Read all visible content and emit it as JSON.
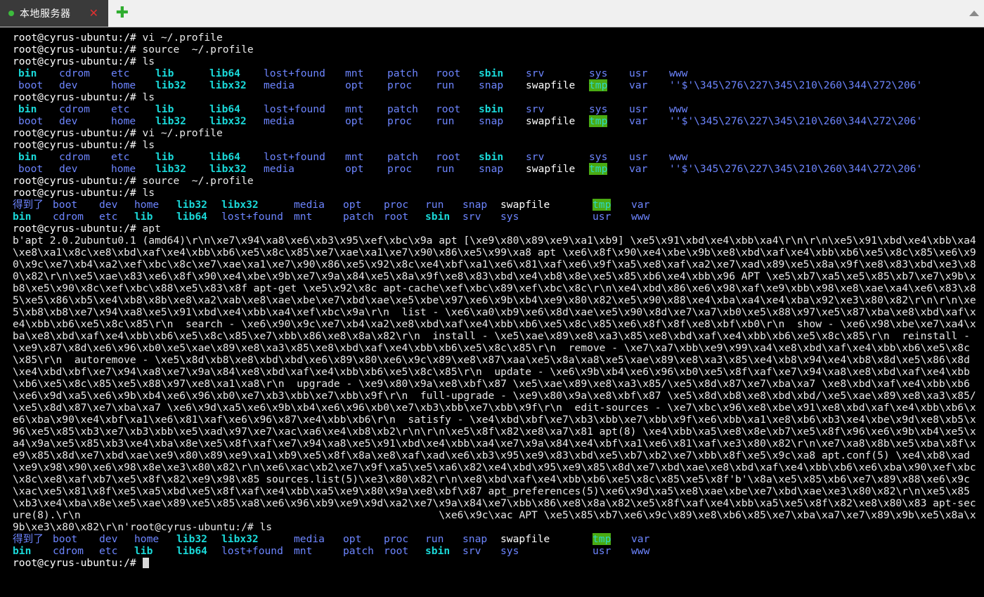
{
  "window": {
    "tab": {
      "status_dot": "status-dot-online",
      "title": "本地服务器",
      "close_label": "✕",
      "add_label": "✚"
    },
    "collapse_icon": "triangle-up-icon"
  },
  "colors": {
    "background": "#000000",
    "foreground": "#e6e6e6",
    "tab_background": "#3a3a3a",
    "tabbar_background": "#f0f0f0",
    "directory": "#6d85ff",
    "symlink": "#1ad9d9",
    "sticky_bg": "#4aab12",
    "sticky_fg": "#2fd6c0",
    "close_red": "#e03030",
    "add_green": "#2fad2f",
    "dot_green": "#3dbb3d"
  },
  "terminal": {
    "prompt": "root@cyrus-ubuntu:/# ",
    "hostname": "cyrus-ubuntu",
    "user": "root",
    "cwd": "/",
    "commands": [
      "vi ~/.profile",
      "source  ~/.profile",
      "ls",
      "apt"
    ],
    "lines": [
      {
        "type": "prompt",
        "command": "vi ~/.profile"
      },
      {
        "type": "prompt",
        "command": "source  ~/.profile"
      },
      {
        "type": "prompt",
        "command": "ls"
      },
      {
        "type": "ls-wide-row1"
      },
      {
        "type": "ls-wide-row2"
      },
      {
        "type": "prompt",
        "command": "ls"
      },
      {
        "type": "ls-wide-row1"
      },
      {
        "type": "ls-wide-row2"
      },
      {
        "type": "prompt",
        "command": "vi ~/.profile"
      },
      {
        "type": "prompt",
        "command": "ls"
      },
      {
        "type": "ls-wide-row1"
      },
      {
        "type": "ls-wide-row2"
      },
      {
        "type": "prompt",
        "command": "source  ~/.profile"
      },
      {
        "type": "prompt",
        "command": "ls"
      },
      {
        "type": "ls-narrow-row1"
      },
      {
        "type": "ls-narrow-row2"
      },
      {
        "type": "prompt",
        "command": "apt"
      },
      {
        "type": "apt-output"
      },
      {
        "type": "ls-narrow-row1"
      },
      {
        "type": "ls-narrow-row2"
      },
      {
        "type": "prompt-cursor",
        "command": ""
      }
    ],
    "ls_wide_row1": [
      {
        "name": "bin",
        "kind": "symlink"
      },
      {
        "name": "cdrom",
        "kind": "dir"
      },
      {
        "name": "etc",
        "kind": "dir"
      },
      {
        "name": "lib",
        "kind": "symlink"
      },
      {
        "name": "lib64",
        "kind": "symlink"
      },
      {
        "name": "lost+found",
        "kind": "dir"
      },
      {
        "name": "mnt",
        "kind": "dir"
      },
      {
        "name": "patch",
        "kind": "dir"
      },
      {
        "name": "root",
        "kind": "dir"
      },
      {
        "name": "sbin",
        "kind": "symlink"
      },
      {
        "name": "srv",
        "kind": "dir"
      },
      {
        "name": "sys",
        "kind": "dir"
      },
      {
        "name": "usr",
        "kind": "dir"
      },
      {
        "name": "www",
        "kind": "dir"
      }
    ],
    "ls_wide_row2": [
      {
        "name": "boot",
        "kind": "dir"
      },
      {
        "name": "dev",
        "kind": "dir"
      },
      {
        "name": "home",
        "kind": "dir"
      },
      {
        "name": "lib32",
        "kind": "symlink"
      },
      {
        "name": "libx32",
        "kind": "symlink"
      },
      {
        "name": "media",
        "kind": "dir"
      },
      {
        "name": "opt",
        "kind": "dir"
      },
      {
        "name": "proc",
        "kind": "dir"
      },
      {
        "name": "run",
        "kind": "dir"
      },
      {
        "name": "snap",
        "kind": "dir"
      },
      {
        "name": "swapfile",
        "kind": "file"
      },
      {
        "name": "tmp",
        "kind": "sticky"
      },
      {
        "name": "var",
        "kind": "dir"
      },
      {
        "name": "''$'\\345\\276\\227\\345\\210\\260\\344\\272\\206'",
        "kind": "dir"
      }
    ],
    "ls_narrow_row1": [
      {
        "name": "得到了",
        "kind": "dir"
      },
      {
        "name": "boot",
        "kind": "dir"
      },
      {
        "name": "dev",
        "kind": "dir"
      },
      {
        "name": "home",
        "kind": "dir"
      },
      {
        "name": "lib32",
        "kind": "symlink"
      },
      {
        "name": "libx32",
        "kind": "symlink"
      },
      {
        "name": "media",
        "kind": "dir"
      },
      {
        "name": "opt",
        "kind": "dir"
      },
      {
        "name": "proc",
        "kind": "dir"
      },
      {
        "name": "run",
        "kind": "dir"
      },
      {
        "name": "snap",
        "kind": "dir"
      },
      {
        "name": "swapfile",
        "kind": "file"
      },
      {
        "name": "tmp",
        "kind": "sticky"
      },
      {
        "name": "var",
        "kind": "dir"
      }
    ],
    "ls_narrow_row2": [
      {
        "name": "bin",
        "kind": "symlink"
      },
      {
        "name": "cdrom",
        "kind": "dir"
      },
      {
        "name": "etc",
        "kind": "dir"
      },
      {
        "name": "lib",
        "kind": "symlink"
      },
      {
        "name": "lib64",
        "kind": "symlink"
      },
      {
        "name": "lost+found",
        "kind": "dir"
      },
      {
        "name": "mnt",
        "kind": "dir"
      },
      {
        "name": "patch",
        "kind": "dir"
      },
      {
        "name": "root",
        "kind": "dir"
      },
      {
        "name": "sbin",
        "kind": "symlink"
      },
      {
        "name": "srv",
        "kind": "dir"
      },
      {
        "name": "sys",
        "kind": "dir"
      },
      {
        "name": "usr",
        "kind": "dir"
      },
      {
        "name": "www",
        "kind": "dir"
      }
    ],
    "apt_output": "b'apt 2.0.2ubuntu0.1 (amd64)\\r\\n\\xe7\\x94\\xa8\\xe6\\xb3\\x95\\xef\\xbc\\x9a apt [\\xe9\\x80\\x89\\xe9\\xa1\\xb9] \\xe5\\x91\\xbd\\xe4\\xbb\\xa4\\r\\n\\r\\n\\xe5\\x91\\xbd\\xe4\\xbb\\xa4\\xe8\\xa1\\x8c\\xe8\\xbd\\xaf\\xe4\\xbb\\xb6\\xe5\\x8c\\x85\\xe7\\xae\\xa1\\xe7\\x90\\x86\\xe5\\x99\\xa8 apt \\xe6\\x8f\\x90\\xe4\\xbe\\x9b\\xe8\\xbd\\xaf\\xe4\\xbb\\xb6\\xe5\\x8c\\x85\\xe6\\x90\\x9c\\xe7\\xb4\\xa2\\xef\\xbc\\x8c\\xe7\\xae\\xa1\\xe7\\x90\\x86\\xe5\\x92\\x8c\\xe4\\xbf\\xa1\\xe6\\x81\\xaf\\xe6\\x9f\\xa5\\xe8\\xaf\\xa2\\xe7\\xad\\x89\\xe5\\x8a\\x9f\\xe8\\x83\\xbd\\xe3\\x80\\x82\\r\\n\\xe5\\xae\\x83\\xe6\\x8f\\x90\\xe4\\xbe\\x9b\\xe7\\x9a\\x84\\xe5\\x8a\\x9f\\xe8\\x83\\xbd\\xe4\\xb8\\x8e\\xe5\\x85\\xb6\\xe4\\xbb\\x96 APT \\xe5\\xb7\\xa5\\xe5\\x85\\xb7\\xe7\\x9b\\xb8\\xe5\\x90\\x8c\\xef\\xbc\\x88\\xe5\\x83\\x8f apt-get \\xe5\\x92\\x8c apt-cache\\xef\\xbc\\x89\\xef\\xbc\\x8c\\r\\n\\xe4\\xbd\\x86\\xe6\\x98\\xaf\\xe9\\xbb\\x98\\xe8\\xae\\xa4\\xe6\\x83\\x85\\xe5\\x86\\xb5\\xe4\\xb8\\x8b\\xe8\\xa2\\xab\\xe8\\xae\\xbe\\xe7\\xbd\\xae\\xe5\\xbe\\x97\\xe6\\x9b\\xb4\\xe9\\x80\\x82\\xe5\\x90\\x88\\xe4\\xba\\xa4\\xe4\\xba\\x92\\xe3\\x80\\x82\\r\\n\\r\\n\\xe5\\xb8\\xb8\\xe7\\x94\\xa8\\xe5\\x91\\xbd\\xe4\\xbb\\xa4\\xef\\xbc\\x9a\\r\\n  list - \\xe6\\xa0\\xb9\\xe6\\x8d\\xae\\xe5\\x90\\x8d\\xe7\\xa7\\xb0\\xe5\\x88\\x97\\xe5\\x87\\xba\\xe8\\xbd\\xaf\\xe4\\xbb\\xb6\\xe5\\x8c\\x85\\r\\n  search - \\xe6\\x90\\x9c\\xe7\\xb4\\xa2\\xe8\\xbd\\xaf\\xe4\\xbb\\xb6\\xe5\\x8c\\x85\\xe6\\x8f\\x8f\\xe8\\xbf\\xb0\\r\\n  show - \\xe6\\x98\\xbe\\xe7\\xa4\\xba\\xe8\\xbd\\xaf\\xe4\\xbb\\xb6\\xe5\\x8c\\x85\\xe7\\xbb\\x86\\xe8\\x8a\\x82\\r\\n  install - \\xe5\\xae\\x89\\xe8\\xa3\\x85\\xe8\\xbd\\xaf\\xe4\\xbb\\xb6\\xe5\\x8c\\x85\\r\\n  reinstall - \\xe9\\x87\\x8d\\xe6\\x96\\xb0\\xe5\\xae\\x89\\xe8\\xa3\\x85\\xe8\\xbd\\xaf\\xe4\\xbb\\xb6\\xe5\\x8c\\x85\\r\\n  remove - \\xe7\\xa7\\xbb\\xe9\\x99\\xa4\\xe8\\xbd\\xaf\\xe4\\xbb\\xb6\\xe5\\x8c\\x85\\r\\n  autoremove - \\xe5\\x8d\\xb8\\xe8\\xbd\\xbd\\xe6\\x89\\x80\\xe6\\x9c\\x89\\xe8\\x87\\xaa\\xe5\\x8a\\xa8\\xe5\\xae\\x89\\xe8\\xa3\\x85\\xe4\\xb8\\x94\\xe4\\xb8\\x8d\\xe5\\x86\\x8d\\xe4\\xbd\\xbf\\xe7\\x94\\xa8\\xe7\\x9a\\x84\\xe8\\xbd\\xaf\\xe4\\xbb\\xb6\\xe5\\x8c\\x85\\r\\n  update - \\xe6\\x9b\\xb4\\xe6\\x96\\xb0\\xe5\\x8f\\xaf\\xe7\\x94\\xa8\\xe8\\xbd\\xaf\\xe4\\xbb\\xb6\\xe5\\x8c\\x85\\xe5\\x88\\x97\\xe8\\xa1\\xa8\\r\\n  upgrade - \\xe9\\x80\\x9a\\xe8\\xbf\\x87 \\xe5\\xae\\x89\\xe8\\xa3\\x85/\\xe5\\x8d\\x87\\xe7\\xba\\xa7 \\xe8\\xbd\\xaf\\xe4\\xbb\\xb6\\xe6\\x9d\\xa5\\xe6\\x9b\\xb4\\xe6\\x96\\xb0\\xe7\\xb3\\xbb\\xe7\\xbb\\x9f\\r\\n  full-upgrade - \\xe9\\x80\\x9a\\xe8\\xbf\\x87 \\xe5\\x8d\\xb8\\xe8\\xbd\\xbd/\\xe5\\xae\\x89\\xe8\\xa3\\x85/\\xe5\\x8d\\x87\\xe7\\xba\\xa7 \\xe6\\x9d\\xa5\\xe6\\x9b\\xb4\\xe6\\x96\\xb0\\xe7\\xb3\\xbb\\xe7\\xbb\\x9f\\r\\n  edit-sources - \\xe7\\xbc\\x96\\xe8\\xbe\\x91\\xe8\\xbd\\xaf\\xe4\\xbb\\xb6\\xe6\\xba\\x90\\xe4\\xbf\\xa1\\xe6\\x81\\xaf\\xe6\\x96\\x87\\xe4\\xbb\\xb6\\r\\n  satisfy - \\xe4\\xbd\\xbf\\xe7\\xb3\\xbb\\xe7\\xbb\\x9f\\xe6\\xbb\\xa1\\xe8\\xb6\\xb3\\xe4\\xbe\\x9d\\xe8\\xb5\\x96\\xe5\\x85\\xb3\\xe7\\xb3\\xbb\\xe5\\xad\\x97\\xe7\\xac\\xa6\\xe4\\xb8\\xb2\\r\\n\\r\\n\\xe5\\x8f\\x82\\xe8\\xa7\\x81 apt(8) \\xe4\\xbb\\xa5\\xe8\\x8e\\xb7\\xe5\\x8f\\x96\\xe6\\x9b\\xb4\\xe5\\xa4\\x9a\\xe5\\x85\\xb3\\xe4\\xba\\x8e\\xe5\\x8f\\xaf\\xe7\\x94\\xa8\\xe5\\x91\\xbd\\xe4\\xbb\\xa4\\xe7\\x9a\\x84\\xe4\\xbf\\xa1\\xe6\\x81\\xaf\\xe3\\x80\\x82\\r\\n\\xe7\\xa8\\x8b\\xe5\\xba\\x8f\\xe9\\x85\\x8d\\xe7\\xbd\\xae\\xe9\\x80\\x89\\xe9\\xa1\\xb9\\xe5\\x8f\\x8a\\xe8\\xaf\\xad\\xe6\\xb3\\x95\\xe9\\x83\\xbd\\xe5\\xb7\\xb2\\xe7\\xbb\\x8f\\xe5\\x9c\\xa8 apt.conf(5) \\xe4\\xb8\\xad\\xe9\\x98\\x90\\xe6\\x98\\x8e\\xe3\\x80\\x82\\r\\n\\xe6\\xac\\xb2\\xe7\\x9f\\xa5\\xe5\\xa6\\x82\\xe4\\xbd\\x95\\xe9\\x85\\x8d\\xe7\\xbd\\xae\\xe8\\xbd\\xaf\\xe4\\xbb\\xb6\\xe6\\xba\\x90\\xef\\xbc\\x8c\\xe8\\xaf\\xb7\\xe5\\x8f\\x82\\xe9\\x98\\x85 sources.list(5)\\xe3\\x80\\x82\\r\\n\\xe8\\xbd\\xaf\\xe4\\xbb\\xb6\\xe5\\x8c\\x85\\xe5\\x8f'b'\\x8a\\xe5\\x85\\xb6\\xe7\\x89\\x88\\xe6\\x9c\\xac\\xe5\\x81\\x8f\\xe5\\xa5\\xbd\\xe5\\x8f\\xaf\\xe4\\xbb\\xa5\\xe9\\x80\\x9a\\xe8\\xbf\\x87 apt_preferences(5)\\xe6\\x9d\\xa5\\xe8\\xae\\xbe\\xe7\\xbd\\xae\\xe3\\x80\\x82\\r\\n\\xe5\\x85\\xb3\\xe4\\xba\\x8e\\xe5\\xae\\x89\\xe5\\x85\\xa8\\xe6\\x96\\xb9\\xe9\\x9d\\xa2\\xe7\\x9a\\x84\\xe7\\xbb\\x86\\xe8\\x8a\\x82\\xe5\\x8f\\xaf\\xe4\\xbb\\xa5\\xe5\\x8f\\x82\\xe8\\x80\\x83 apt-secure(8).\\r\\n                                                          \\xe6\\x9c\\xac APT \\xe5\\x85\\xb7\\xe6\\x9c\\x89\\xe8\\xb6\\x85\\xe7\\xba\\xa7\\xe7\\x89\\x9b\\xe5\\x8a\\x9b\\xe3\\x80\\x82\\r\\n'root@cyrus-ubuntu:/# ls"
  }
}
